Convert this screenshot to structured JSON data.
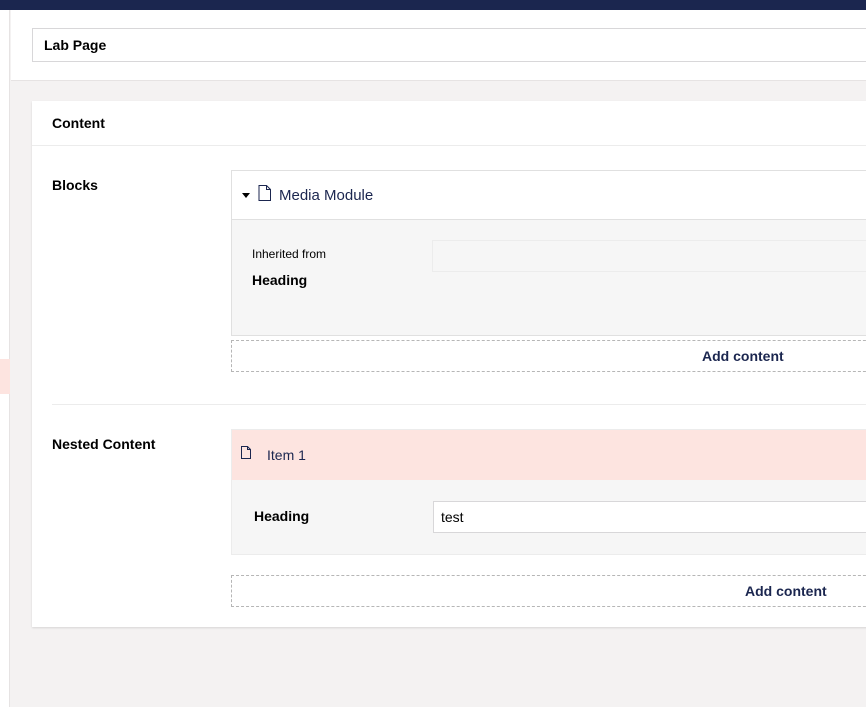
{
  "header": {
    "page_name": "Lab Page"
  },
  "content_panel": {
    "title": "Content",
    "blocks": {
      "label": "Blocks",
      "block_title": "Media Module",
      "inherited_label": "Inherited from",
      "heading_label": "Heading",
      "add_content_label": "Add content"
    },
    "nested_content": {
      "label": "Nested Content",
      "item_title": "Item 1",
      "heading_label": "Heading",
      "heading_value": "test",
      "add_content_label": "Add content"
    }
  },
  "icons": {
    "caret": "caret-down-icon",
    "document": "document-icon"
  },
  "colors": {
    "topbar": "#1b264f",
    "nested_item_highlight": "#fde4e0",
    "text_primary": "#1b264f"
  }
}
